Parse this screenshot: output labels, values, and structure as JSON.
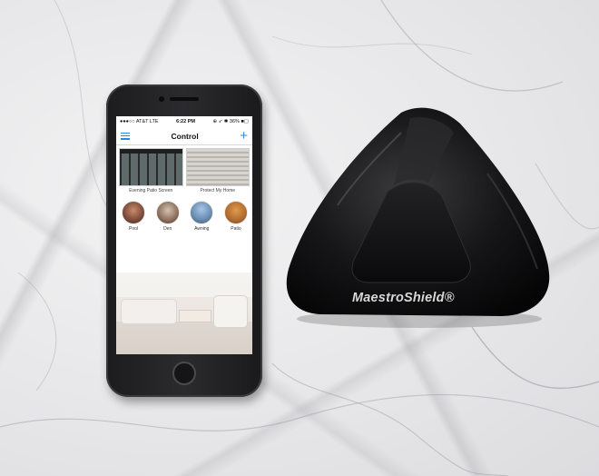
{
  "status_bar": {
    "carrier": "●●●○○ AT&T  LTE",
    "time": "6:22 PM",
    "battery": "⊕ ➶ ✱ 36% ■▢"
  },
  "nav": {
    "title": "Control",
    "menu_icon": "hamburger-menu-icon",
    "add_icon": "plus-icon",
    "add_glyph": "+",
    "accent_color": "#1f8ce6"
  },
  "scenes": [
    {
      "label": "Evening Patio Screen"
    },
    {
      "label": "Protect My Home"
    }
  ],
  "devices": [
    {
      "label": "Pool"
    },
    {
      "label": "Den"
    },
    {
      "label": "Awning"
    },
    {
      "label": "Patio"
    }
  ],
  "hub": {
    "brand": "MaestroShield®"
  }
}
